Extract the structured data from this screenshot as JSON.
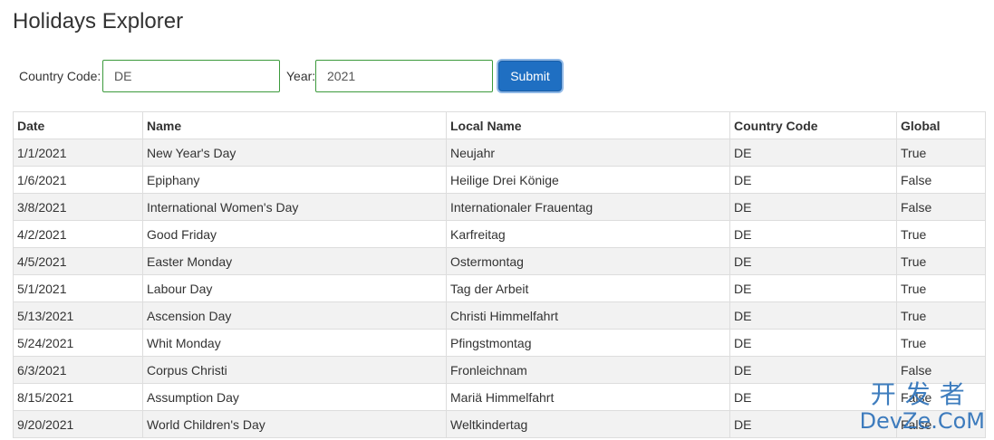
{
  "page": {
    "title": "Holidays Explorer"
  },
  "form": {
    "country_label": "Country Code:",
    "country_value": "DE",
    "year_label": "Year:",
    "year_value": "2021",
    "submit_label": "Submit"
  },
  "table": {
    "headers": [
      "Date",
      "Name",
      "Local Name",
      "Country Code",
      "Global"
    ],
    "rows": [
      [
        "1/1/2021",
        "New Year's Day",
        "Neujahr",
        "DE",
        "True"
      ],
      [
        "1/6/2021",
        "Epiphany",
        "Heilige Drei Könige",
        "DE",
        "False"
      ],
      [
        "3/8/2021",
        "International Women's Day",
        "Internationaler Frauentag",
        "DE",
        "False"
      ],
      [
        "4/2/2021",
        "Good Friday",
        "Karfreitag",
        "DE",
        "True"
      ],
      [
        "4/5/2021",
        "Easter Monday",
        "Ostermontag",
        "DE",
        "True"
      ],
      [
        "5/1/2021",
        "Labour Day",
        "Tag der Arbeit",
        "DE",
        "True"
      ],
      [
        "5/13/2021",
        "Ascension Day",
        "Christi Himmelfahrt",
        "DE",
        "True"
      ],
      [
        "5/24/2021",
        "Whit Monday",
        "Pfingstmontag",
        "DE",
        "True"
      ],
      [
        "6/3/2021",
        "Corpus Christi",
        "Fronleichnam",
        "DE",
        "False"
      ],
      [
        "8/15/2021",
        "Assumption Day",
        "Mariä Himmelfahrt",
        "DE",
        "False"
      ],
      [
        "9/20/2021",
        "World Children's Day",
        "Weltkindertag",
        "DE",
        "False"
      ]
    ]
  },
  "watermark": {
    "top": "开发者",
    "bottom": "DevZe.CoM"
  },
  "colors": {
    "submit_bg": "#1f6fc2",
    "input_border": "#3c9a3c",
    "row_stripe": "#f2f2f2",
    "watermark": "#2a6fb8"
  }
}
